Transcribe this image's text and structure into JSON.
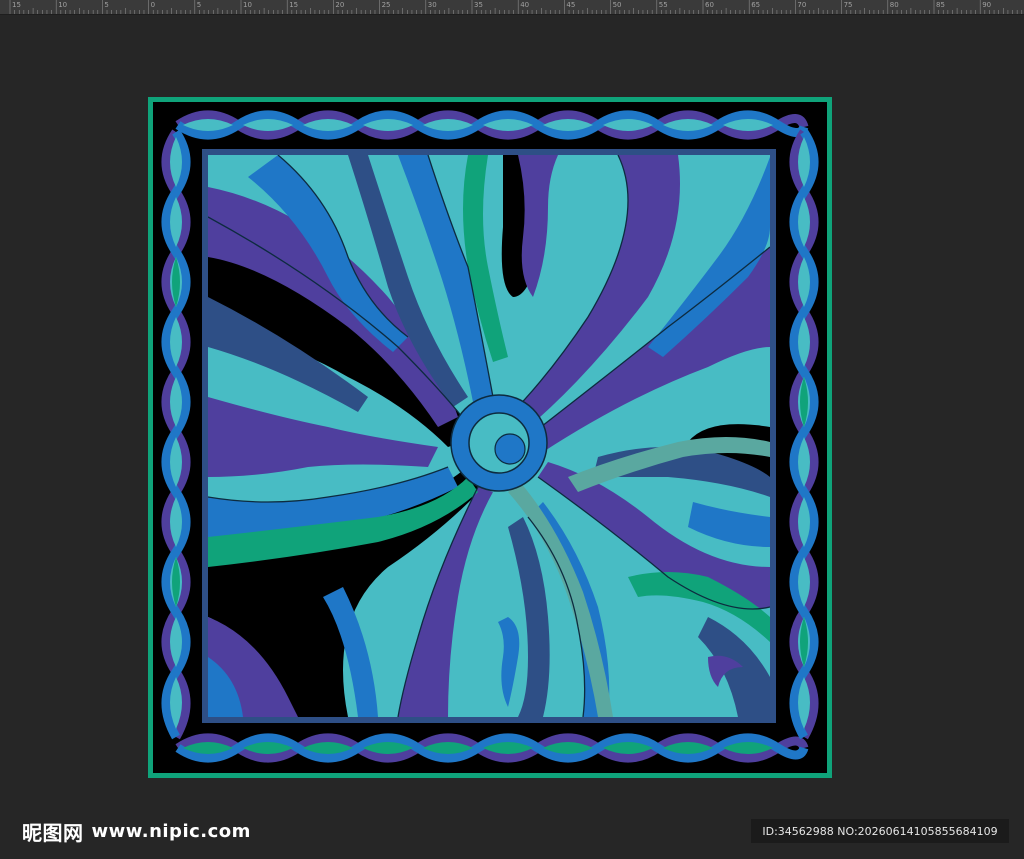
{
  "ruler": {
    "labels": [
      "15",
      "10",
      "5",
      "0",
      "5",
      "10",
      "15",
      "20",
      "25",
      "30",
      "35",
      "40",
      "45",
      "50",
      "55",
      "60",
      "65",
      "70",
      "75",
      "80",
      "85",
      "90"
    ]
  },
  "watermark": {
    "brand": "昵图网",
    "url": "www.nipic.com",
    "id_line": "ID:34562988 NO:20260614105855684109"
  },
  "colors": {
    "workspace": "#262626",
    "ruler_bg": "#3a3a3a",
    "frame_green": "#0fa37a",
    "black": "#000000",
    "turquoise": "#48bcc4",
    "blue": "#1f77c7",
    "purple": "#4f3f9e",
    "navy": "#2e4f86",
    "green": "#10a37a"
  },
  "icons": {
    "artwork": "psychedelic-swirl-scarf-image"
  }
}
